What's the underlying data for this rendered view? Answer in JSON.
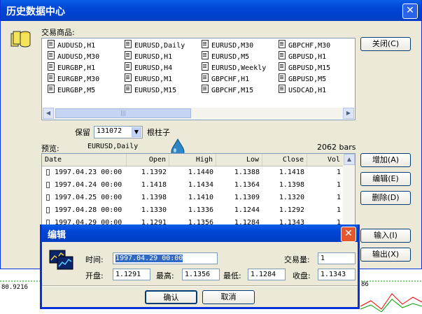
{
  "window": {
    "title": "历史数据中心",
    "products_label": "交易商品:",
    "close_button": "关闭(C)",
    "keep_label": "保留",
    "keep_value": "131072",
    "bars_label": "根柱子",
    "preview_label": "预览:",
    "preview_symbol": "EURUSD,Daily",
    "bars_count": "2062 bars"
  },
  "products": [
    [
      "AUDUSD,H1",
      "EURUSD,Daily",
      "EURUSD,M30",
      "GBPCHF,M30"
    ],
    [
      "AUDUSD,M30",
      "EURUSD,H1",
      "EURUSD,M5",
      "GBPUSD,H1"
    ],
    [
      "EURGBP,H1",
      "EURUSD,H4",
      "EURUSD,Weekly",
      "GBPUSD,M15"
    ],
    [
      "EURGBP,M30",
      "EURUSD,M1",
      "GBPCHF,H1",
      "GBPUSD,M5"
    ],
    [
      "EURGBP,M5",
      "EURUSD,M15",
      "GBPCHF,M15",
      "USDCAD,H1"
    ]
  ],
  "table": {
    "columns": [
      "Date",
      "Open",
      "High",
      "Low",
      "Close",
      "Vol"
    ],
    "rows": [
      [
        "1997.04.23 00:00",
        "1.1392",
        "1.1440",
        "1.1388",
        "1.1418",
        "1"
      ],
      [
        "1997.04.24 00:00",
        "1.1418",
        "1.1434",
        "1.1364",
        "1.1398",
        "1"
      ],
      [
        "1997.04.25 00:00",
        "1.1398",
        "1.1410",
        "1.1309",
        "1.1320",
        "1"
      ],
      [
        "1997.04.28 00:00",
        "1.1330",
        "1.1336",
        "1.1244",
        "1.1292",
        "1"
      ],
      [
        "1997.04.29 00:00",
        "1.1291",
        "1.1356",
        "1.1284",
        "1.1343",
        "1"
      ]
    ]
  },
  "side_buttons": {
    "add": "增加(A)",
    "edit": "编辑(E)",
    "delete": "删除(D)",
    "import": "输入(I)",
    "export": "输出(X)"
  },
  "edit_dialog": {
    "title": "编辑",
    "time_label": "时间:",
    "time_value": "1997.04.29 00:00",
    "volume_label": "交易量:",
    "volume_value": "1",
    "open_label": "开盘:",
    "open_value": "1.1291",
    "high_label": "最高:",
    "high_value": "1.1356",
    "low_label": "最低:",
    "low_value": "1.1284",
    "close_label": "收盘:",
    "close_value": "1.1343",
    "ok_button": "确认",
    "cancel_button": "取消"
  },
  "background": {
    "price_label": "80.9216",
    "tick_label": "86"
  },
  "colors": {
    "titlebar": "#0046d5",
    "selection": "#316ac5",
    "close_red": "#e5572d",
    "chart_green": "#00a000",
    "chart_red": "#ff0000"
  }
}
